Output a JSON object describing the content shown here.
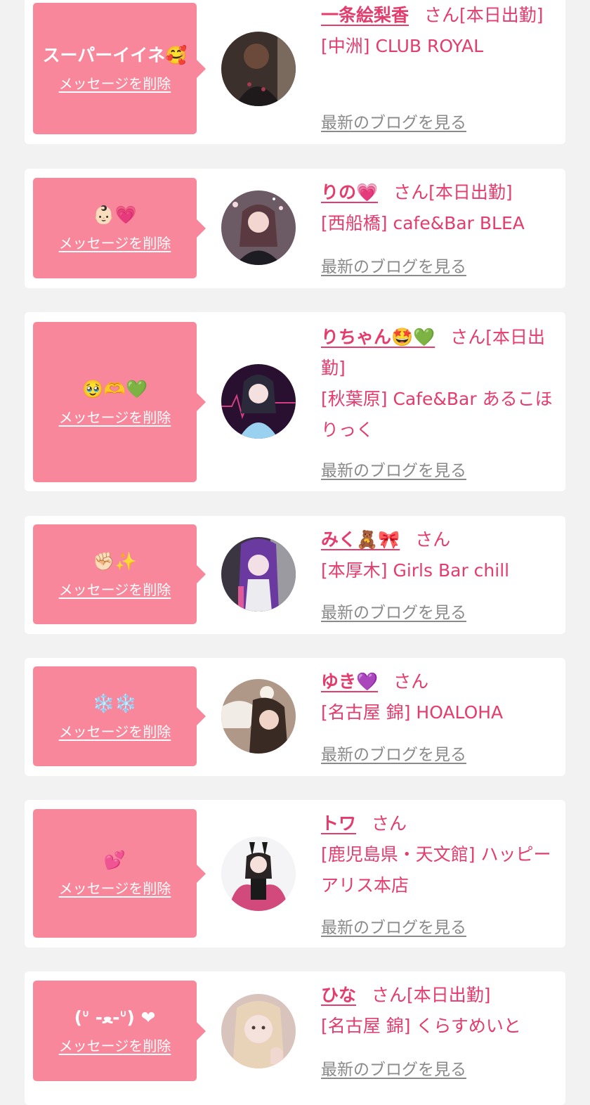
{
  "delete_label": "メッセージを削除",
  "blog_label": "最新のブログを見る",
  "honorific": "さん",
  "items": [
    {
      "message": "スーパーイイネ🥰",
      "name": "一条絵梨香",
      "status": "[本日出勤]",
      "store": "[中洲] CLUB ROYAL",
      "avatar_color": "#4a3a34"
    },
    {
      "message": "👶🏻💗",
      "name": "りの💗",
      "status": "[本日出勤]",
      "store": "[西船橋] cafe&Bar BLEA",
      "avatar_color": "#8a5a6a"
    },
    {
      "message": "🥹🫶💚",
      "name": "りちゃん🤩💚",
      "status": "[本日出勤]",
      "store": "[秋葉原] Cafe&Bar あるこほりっく",
      "avatar_color": "#5a2a6a"
    },
    {
      "message": "✊🏻✨",
      "name": "みく🧸🎀",
      "status": "",
      "store": "[本厚木] Girls Bar chill",
      "avatar_color": "#5a3a7a"
    },
    {
      "message": "❄️❄️",
      "name": "ゆき💜",
      "status": "",
      "store": "[名古屋 錦] HOALOHA",
      "avatar_color": "#a08070"
    },
    {
      "message": "💕",
      "name": "トワ",
      "status": "",
      "store": "[鹿児島県・天文館] ハッピーアリス本店",
      "avatar_color": "#d96a90"
    },
    {
      "message": "(ᐡ -ﻌ-ᐡ) ❤",
      "name": "ひな",
      "status": "[本日出勤]",
      "store": "[名古屋 錦] くらすめいと",
      "avatar_color": "#c8a8a0"
    }
  ]
}
